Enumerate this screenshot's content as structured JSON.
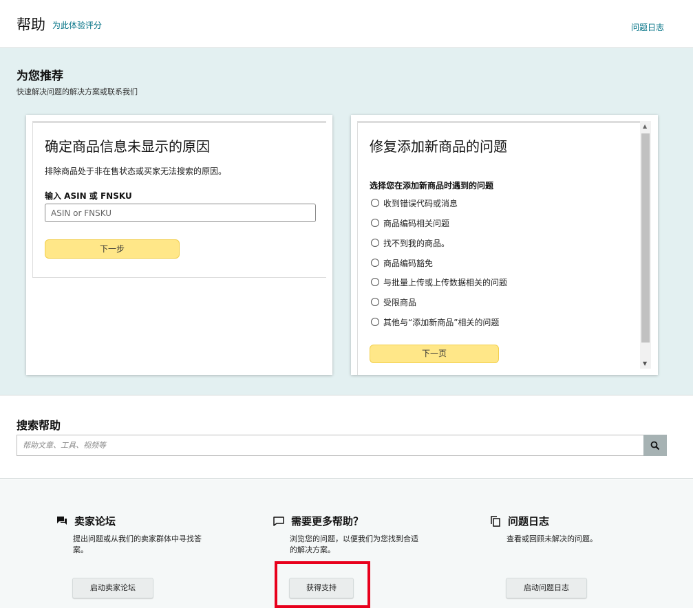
{
  "header": {
    "title": "帮助",
    "rate_link": "为此体验评分",
    "case_log_link": "问题日志"
  },
  "recommend": {
    "heading": "为您推荐",
    "subheading": "快速解决问题的解决方案或联系我们",
    "card1": {
      "title": "确定商品信息未显示的原因",
      "description": "排除商品处于非在售状态或买家无法搜索的原因。",
      "input_label": "输入 ASIN 或 FNSKU",
      "input_placeholder": "ASIN or FNSKU",
      "next_button": "下一步"
    },
    "card2": {
      "title": "修复添加新商品的问题",
      "question": "选择您在添加新商品时遇到的问题",
      "options": [
        "收到错误代码或消息",
        "商品编码相关问题",
        "找不到我的商品。",
        "商品编码豁免",
        "与批量上传或上传数据相关的问题",
        "受限商品",
        "其他与“添加新商品”相关的问题"
      ],
      "next_button": "下一页"
    }
  },
  "search": {
    "heading": "搜索帮助",
    "placeholder": "帮助文章、工具、视频等"
  },
  "bottom": {
    "forum": {
      "title": "卖家论坛",
      "description": "提出问题或从我们的卖家群体中寻找答案。",
      "button": "启动卖家论坛"
    },
    "support": {
      "title": "需要更多帮助？",
      "description": "浏览您的问题，以便我们为您找到合适的解决方案。",
      "button": "获得支持"
    },
    "case_log": {
      "title": "问题日志",
      "description": "查看或回顾未解决的问题。",
      "button": "启动问题日志"
    }
  },
  "colors": {
    "link": "#007185",
    "band_bg": "#e3f0f1",
    "yellow_button": "#ffe788",
    "highlight": "#e8001c"
  }
}
